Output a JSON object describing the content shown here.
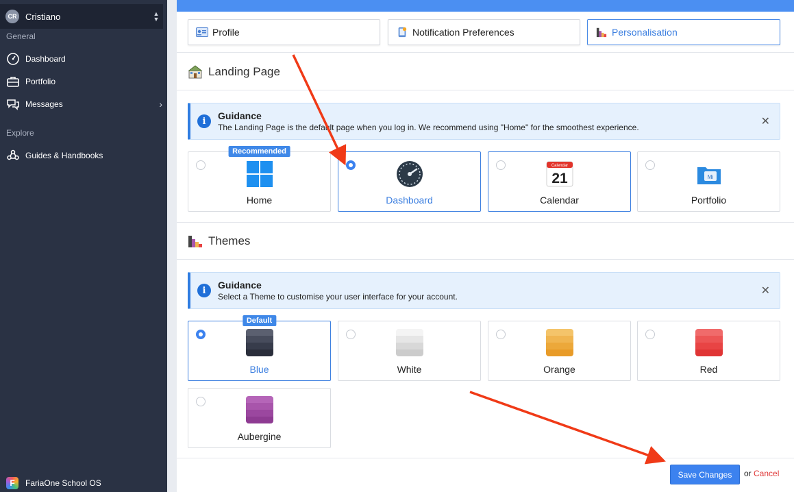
{
  "sidebar": {
    "user": {
      "initials": "CR",
      "name": "Cristiano"
    },
    "section_general": "General",
    "section_explore": "Explore",
    "items": [
      {
        "label": "Dashboard",
        "icon": "dashboard-icon"
      },
      {
        "label": "Portfolio",
        "icon": "briefcase-icon"
      },
      {
        "label": "Messages",
        "icon": "messages-icon"
      },
      {
        "label": "Guides & Handbooks",
        "icon": "guides-icon"
      }
    ],
    "brand": {
      "logo_letter": "F",
      "label": "FariaOne School OS"
    }
  },
  "tabs": [
    {
      "label": "Profile",
      "icon": "profile-card-icon"
    },
    {
      "label": "Notification Preferences",
      "icon": "notification-icon"
    },
    {
      "label": "Personalisation",
      "icon": "personalisation-icon",
      "active": true
    }
  ],
  "landing": {
    "title": "Landing Page",
    "guidance_title": "Guidance",
    "guidance_text": "The Landing Page is the default page when you log in. We recommend using \"Home\" for the smoothest experience.",
    "options": [
      {
        "label": "Home",
        "badge": "Recommended"
      },
      {
        "label": "Dashboard",
        "selected": true
      },
      {
        "label": "Calendar",
        "calendar_month": "Calendar",
        "calendar_day": "21"
      },
      {
        "label": "Portfolio",
        "portfolio_text": "Mi"
      }
    ]
  },
  "themes": {
    "title": "Themes",
    "guidance_title": "Guidance",
    "guidance_text": "Select a Theme to customise your user interface for your account.",
    "options": [
      {
        "label": "Blue",
        "badge": "Default",
        "selected": true,
        "colors": [
          "#5b6070",
          "#474c5c",
          "#373c4b",
          "#2a2e3b"
        ]
      },
      {
        "label": "White",
        "colors": [
          "#f4f4f4",
          "#e6e6e6",
          "#d8d8d8",
          "#cccccc"
        ]
      },
      {
        "label": "Orange",
        "colors": [
          "#f4c46a",
          "#f0b550",
          "#eca83a",
          "#e89b28"
        ]
      },
      {
        "label": "Red",
        "colors": [
          "#f06b6b",
          "#ec5555",
          "#e84444",
          "#e03535"
        ]
      },
      {
        "label": "Aubergine",
        "colors": [
          "#b565b8",
          "#a855ab",
          "#9b479f",
          "#8e3b92"
        ]
      }
    ]
  },
  "footer": {
    "save_label": "Save Changes",
    "or_text": "or",
    "cancel_label": "Cancel"
  },
  "colors": {
    "accent": "#3c82ef",
    "sidebar_bg": "#2a3244",
    "annotation_arrow": "#f03a17"
  }
}
